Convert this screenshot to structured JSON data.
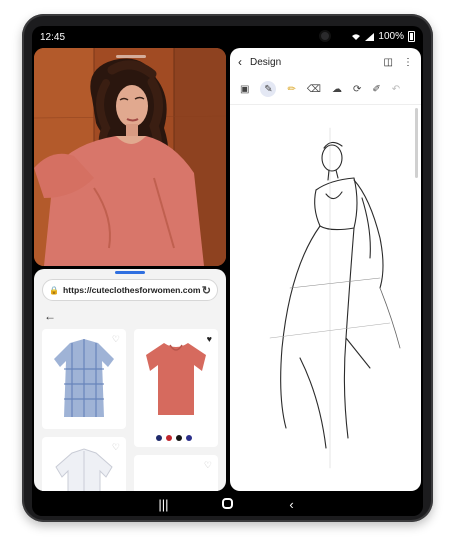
{
  "status_bar": {
    "time": "12:45",
    "battery": "100%",
    "signal_icons": [
      "wifi-icon",
      "signal-icon",
      "battery-icon"
    ]
  },
  "photo_pane": {
    "subject": "woman-in-coral-blouse-photo"
  },
  "browser": {
    "url": "https://cuteclothesforwomen.com",
    "products": [
      {
        "name": "blue-plaid-shirt-image",
        "favorited": false
      },
      {
        "name": "coral-blouse-image",
        "favorited": true,
        "color_swatches": [
          "#1f2a6b",
          "#c0262d",
          "#151515",
          "#2b2f8a"
        ]
      },
      {
        "name": "white-blouse-image",
        "favorited": false
      },
      {
        "name": "product-4-image",
        "favorited": false
      }
    ]
  },
  "notes_app": {
    "title": "Design",
    "toolbar": [
      "text-tool-icon",
      "pen-tool-icon",
      "highlighter-tool-icon",
      "eraser-tool-icon",
      "shape-tool-icon",
      "lasso-tool-icon",
      "style-tool-icon",
      "undo-icon"
    ]
  },
  "navigation": [
    "recent-apps-button",
    "home-button",
    "back-button"
  ],
  "colors": {
    "accent": "#2f6fe0",
    "photo_background": "#a24e25",
    "blouse": "#d8766a"
  }
}
